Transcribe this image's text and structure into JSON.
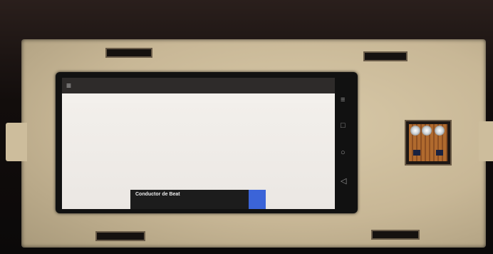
{
  "photo": {
    "colors": {
      "wood": "#cdbd9c",
      "slot": "#15110f",
      "screen": "#eeeae6",
      "appbar": "#2e2b2a",
      "snackbar_text": "#3ecf3e",
      "snackbar_action": "#3b64d8"
    },
    "phone": {
      "app_bar": {
        "menu_icon": "menu-icon"
      },
      "snackbar": {
        "title": "Conductor de Beat"
      },
      "nav_icons": [
        "menu-lines-icon",
        "square-icon",
        "circle-icon",
        "triangle-back-icon"
      ]
    },
    "module_icon": "led-pcb"
  }
}
